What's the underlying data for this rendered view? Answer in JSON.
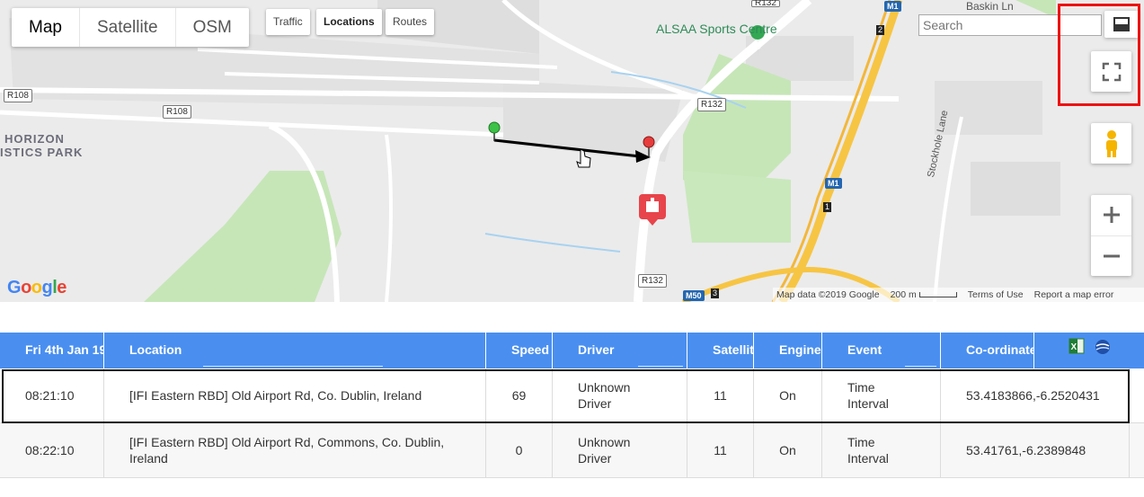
{
  "map": {
    "type_tabs": [
      "Map",
      "Satellite",
      "OSM"
    ],
    "active_type": "Map",
    "layers": [
      "Traffic",
      "Locations",
      "Routes"
    ],
    "active_layer": "Locations",
    "search_placeholder": "Search",
    "labels": {
      "alsaa": "ALSAA Sports Centre",
      "baskin": "Baskin Ln",
      "horizon1": "HORIZON",
      "horizon2": "ISTICS PARK",
      "stockhole": "Stockhole Lane"
    },
    "road_shields": {
      "r108a": "R108",
      "r108b": "R108",
      "r132a": "R132",
      "r132b": "R132",
      "r132c": "R132",
      "m1a": "M1",
      "m1b": "M1",
      "m50": "M50",
      "j2": "2",
      "j1": "1",
      "j3": "3"
    },
    "attribution": {
      "map_data": "Map data ©2019 Google",
      "scale": "200 m",
      "terms": "Terms of Use",
      "report": "Report a map error"
    },
    "logo_text": "Google",
    "icons": {
      "pan": "pan-cursor-icon",
      "fullscreen": "fullscreen-icon",
      "collapse": "collapse-map-icon",
      "pegman": "pegman-icon",
      "zoom_in": "plus-icon",
      "zoom_out": "minus-icon"
    },
    "highlight_color": "#ee1111"
  },
  "table": {
    "header_color": "#4a8ff0",
    "columns": [
      "Fri 4th Jan 19",
      "Location",
      "Speed",
      "Driver",
      "Satellites",
      "Engine",
      "Event",
      "Co-ordinates"
    ],
    "export_icons": [
      "excel-export-icon",
      "google-earth-icon"
    ],
    "rows": [
      {
        "time": "08:21:10",
        "location": "[IFI Eastern RBD] Old Airport Rd, Co. Dublin, Ireland",
        "speed": "69",
        "driver": "Unknown Driver",
        "satellites": "11",
        "engine": "On",
        "event": "Time Interval",
        "coords": "53.4183866,-6.2520431"
      },
      {
        "time": "08:22:10",
        "location": "[IFI Eastern RBD] Old Airport Rd, Commons, Co. Dublin, Ireland",
        "speed": "0",
        "driver": "Unknown Driver",
        "satellites": "11",
        "engine": "On",
        "event": "Time Interval",
        "coords": "53.41761,-6.2389848"
      }
    ]
  }
}
